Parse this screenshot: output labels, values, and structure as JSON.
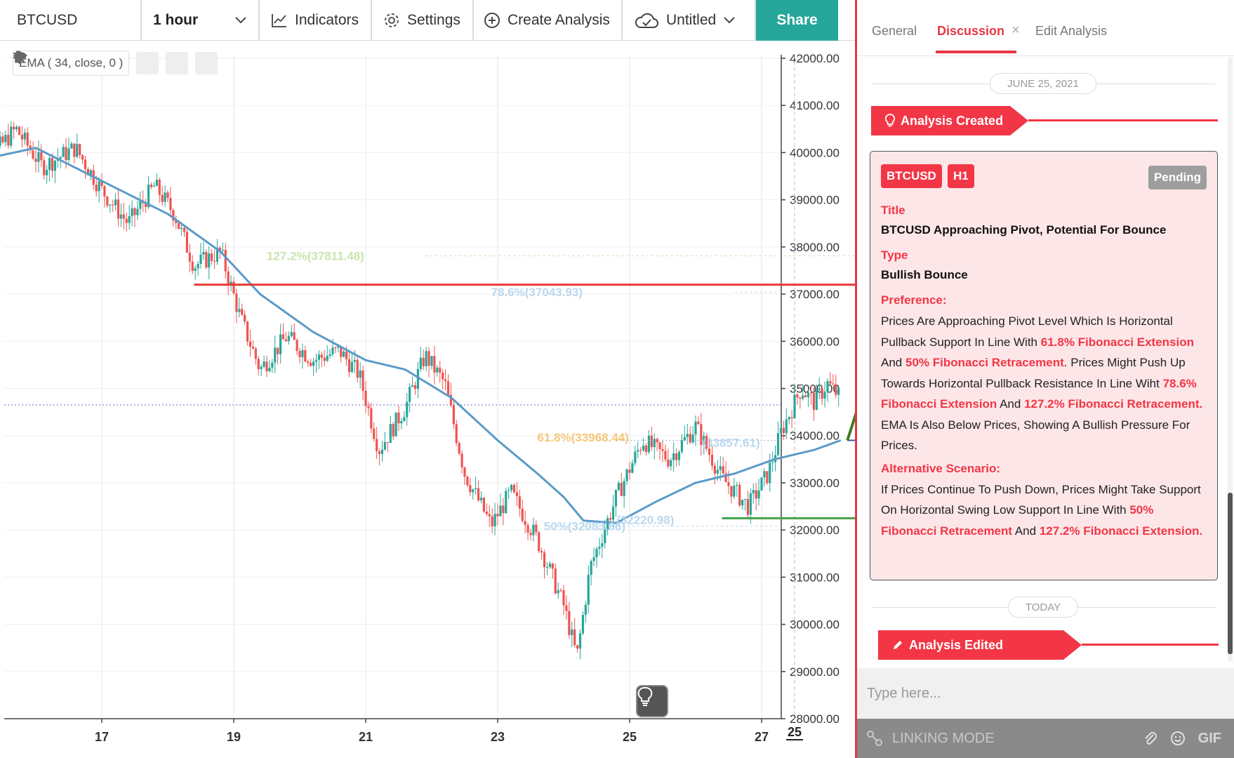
{
  "toolbar": {
    "symbol": "BTCUSD",
    "interval": "1 hour",
    "indicators_label": "Indicators",
    "settings_label": "Settings",
    "create_label": "Create Analysis",
    "layout_name": "Untitled",
    "share_label": "Share"
  },
  "legend": {
    "ema_label": "EMA ( 34, close, 0 )"
  },
  "colors": {
    "up": "#26a69a",
    "down": "#ef5350",
    "ema": "#5b9bc8",
    "accent": "#f23645",
    "share": "#26a69a"
  },
  "chart_data": {
    "type": "candlestick",
    "symbol": "BTCUSD",
    "timeframe": "1 hour",
    "y_ticks": [
      "42000.00",
      "41000.00",
      "40000.00",
      "39000.00",
      "38000.00",
      "37000.00",
      "36000.00",
      "35000.00",
      "34000.00",
      "33000.00",
      "32000.00",
      "31000.00",
      "30000.00",
      "29000.00",
      "28000.00"
    ],
    "ylim": [
      28000,
      42000
    ],
    "x_ticks": [
      "17",
      "19",
      "21",
      "23",
      "25",
      "27"
    ],
    "x_current": "25",
    "price_path": [
      [
        15.0,
        40300
      ],
      [
        15.3,
        39900
      ],
      [
        15.7,
        40500
      ],
      [
        16.1,
        39700
      ],
      [
        16.6,
        40100
      ],
      [
        17.0,
        39200
      ],
      [
        17.4,
        38500
      ],
      [
        17.8,
        39300
      ],
      [
        18.1,
        38700
      ],
      [
        18.4,
        37600
      ],
      [
        18.8,
        37900
      ],
      [
        19.1,
        36500
      ],
      [
        19.4,
        35400
      ],
      [
        19.8,
        36100
      ],
      [
        20.2,
        35600
      ],
      [
        20.6,
        35800
      ],
      [
        20.9,
        35300
      ],
      [
        21.2,
        33700
      ],
      [
        21.6,
        34600
      ],
      [
        21.9,
        35700
      ],
      [
        22.2,
        35100
      ],
      [
        22.5,
        33200
      ],
      [
        22.9,
        32100
      ],
      [
        23.2,
        32800
      ],
      [
        23.6,
        31800
      ],
      [
        24.0,
        30400
      ],
      [
        24.2,
        29300
      ],
      [
        24.4,
        31200
      ],
      [
        24.8,
        32700
      ],
      [
        25.2,
        33900
      ],
      [
        25.6,
        33500
      ],
      [
        26.0,
        34200
      ],
      [
        26.4,
        33100
      ],
      [
        26.8,
        32500
      ],
      [
        27.1,
        33200
      ],
      [
        27.3,
        34100
      ],
      [
        27.6,
        35000
      ],
      [
        27.8,
        34700
      ],
      [
        28.0,
        35100
      ],
      [
        28.2,
        34800
      ]
    ],
    "ema_34": [
      [
        15.0,
        39800
      ],
      [
        16.0,
        40100
      ],
      [
        17.0,
        39400
      ],
      [
        18.0,
        38700
      ],
      [
        18.8,
        37900
      ],
      [
        19.4,
        37000
      ],
      [
        20.2,
        36200
      ],
      [
        21.0,
        35600
      ],
      [
        21.6,
        35400
      ],
      [
        22.3,
        34800
      ],
      [
        23.0,
        33900
      ],
      [
        23.6,
        33200
      ],
      [
        24.0,
        32700
      ],
      [
        24.3,
        32200
      ],
      [
        24.8,
        32150
      ],
      [
        25.4,
        32600
      ],
      [
        26.0,
        33000
      ],
      [
        26.6,
        33200
      ],
      [
        27.2,
        33500
      ],
      [
        27.8,
        33700
      ],
      [
        28.2,
        33900
      ]
    ],
    "last_price": 34650,
    "levels": [
      {
        "name": "resistance",
        "value": 37200,
        "color": "#e53935"
      },
      {
        "name": "pivot",
        "value": 33900,
        "color": "#3f51b5"
      },
      {
        "name": "support",
        "value": 32250,
        "color": "#43a047"
      }
    ],
    "fib_labels": [
      {
        "text": "127.2%(37811.48)",
        "value": 37811.48,
        "color": "#c5e1a5"
      },
      {
        "text": "78.6%(37043.93)",
        "value": 37043.93,
        "color": "#b3d4ee"
      },
      {
        "text": "61.8%(33968.44)",
        "value": 33968.44,
        "color": "#f5c26b"
      },
      {
        "text": "(33857.61)",
        "value": 33857.61,
        "color": "#b3d4ee"
      },
      {
        "text": "50%(32083.66)",
        "value": 32083.66,
        "color": "#b3d4ee"
      },
      {
        "text": "(32220.98)",
        "value": 32220.98,
        "color": "#b3d4ee"
      }
    ],
    "arrow": {
      "from": [
        28.3,
        33900
      ],
      "to": [
        29.0,
        37100
      ],
      "color": "#3b7d23"
    }
  },
  "panel": {
    "tabs": {
      "general": "General",
      "discussion": "Discussion",
      "edit": "Edit Analysis"
    },
    "date_1": "JUNE 25, 2021",
    "event_1": "Analysis Created",
    "card": {
      "symbol": "BTCUSD",
      "timeframe": "H1",
      "status": "Pending",
      "title_label": "Title",
      "title": "BTCUSD Approaching Pivot, Potential For Bounce",
      "type_label": "Type",
      "type": "Bullish Bounce",
      "pref_label": "Preference:",
      "pref": [
        {
          "t": "Prices Are Approaching Pivot Level Which Is Horizontal Pullback Support In Line With ",
          "hl": false
        },
        {
          "t": "61.8% Fibonacci Extension",
          "hl": true
        },
        {
          "t": " And ",
          "hl": false
        },
        {
          "t": "50% Fibonacci Retracement",
          "hl": true
        },
        {
          "t": ". Prices Might Push Up Towards Horizontal Pullback Resistance In Line Wiht ",
          "hl": false
        },
        {
          "t": "78.6% Fibonacci Extension",
          "hl": true
        },
        {
          "t": " And ",
          "hl": false
        },
        {
          "t": "127.2% Fibonacci Retracement.",
          "hl": true
        },
        {
          "t": " EMA Is Also Below Prices, Showing A Bullish Pressure For Prices.",
          "hl": false
        }
      ],
      "alt_label": "Alternative Scenario:",
      "alt": [
        {
          "t": "If Prices Continue To Push Down, Prices Might Take Support On Horizontal Swing Low Support In Line With ",
          "hl": false
        },
        {
          "t": "50% Fibonacci Retracement",
          "hl": true
        },
        {
          "t": " And ",
          "hl": false
        },
        {
          "t": "127.2% Fibonacci Extension.",
          "hl": true
        }
      ]
    },
    "date_2": "TODAY",
    "event_2": "Analysis Edited",
    "composer_placeholder": "Type here...",
    "linking_mode": "LINKING MODE",
    "gif_label": "GIF"
  }
}
